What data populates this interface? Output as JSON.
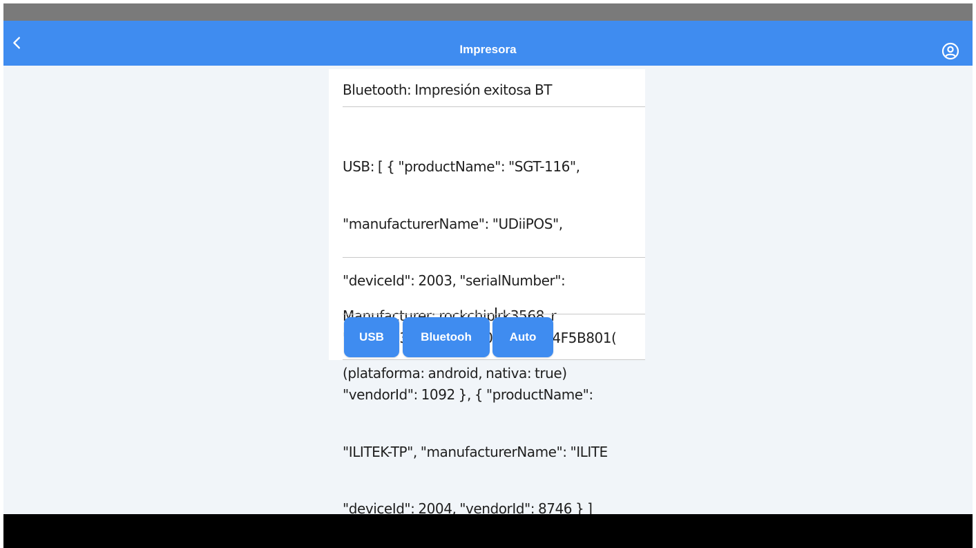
{
  "header": {
    "title": "Impresora",
    "back_icon": "chevron-left-icon",
    "account_icon": "user-circle-icon"
  },
  "colors": {
    "accent": "#3f8cf0",
    "background": "#f1f5f9",
    "card": "#ffffff",
    "status_bar": "#7a7a7a",
    "nav_bar": "#000000"
  },
  "printer": {
    "bluetooth_line": "Bluetooth: Impresión exitosa BT",
    "usb_lines": [
      "USB: [ { \"productName\": \"SGT-116\",",
      "\"manufacturerName\": \"UDiiPOS\",",
      "\"deviceId\": 2003, \"serialNumber\":",
      "\"3130313238385143000000054F5B801(",
      "\"vendorId\": 1092 }, { \"productName\":",
      "\"ILITEK-TP\", \"manufacturerName\": \"ILITE",
      "\"deviceId\": 2004, \"vendorId\": 8746 } ]"
    ],
    "manufacturer_before_cursor": "Manufacturer: rockchip",
    "manufacturer_after_cursor": "rk3568_r",
    "manufacturer_line2": "(plataforma: android, nativa: true)"
  },
  "buttons": {
    "usb": "USB",
    "bluetooth": "Bluetooh",
    "auto": "Auto"
  }
}
